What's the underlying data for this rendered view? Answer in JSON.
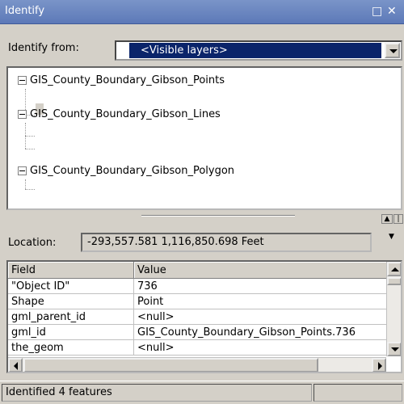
{
  "window": {
    "title": "Identify",
    "controls": {
      "restore": "□",
      "close": "✕"
    }
  },
  "identify_from": {
    "label": "Identify from:",
    "selected": "<Visible layers>"
  },
  "tree": {
    "layers": [
      {
        "name": "GIS_County_Boundary_Gibson_Points"
      },
      {
        "name": "GIS_County_Boundary_Gibson_Lines"
      },
      {
        "name": "GIS_County_Boundary_Gibson_Polygon"
      }
    ]
  },
  "location": {
    "label": "Location:",
    "value": "-293,557.581  1,116,850.698 Feet"
  },
  "grid": {
    "columns": [
      "Field",
      "Value"
    ],
    "rows": [
      [
        "\"Object ID\"",
        "736"
      ],
      [
        "Shape",
        "Point"
      ],
      [
        "gml_parent_id",
        "<null>"
      ],
      [
        "gml_id",
        "GIS_County_Boundary_Gibson_Points.736"
      ],
      [
        "the_geom",
        "<null>"
      ]
    ]
  },
  "status": {
    "text": "Identified 4 features"
  },
  "icons": {
    "dropdown": "chevron-down-icon",
    "expander": "collapse-minus-icon"
  },
  "colors": {
    "titlebar": "#5d79b8",
    "selection": "#0a246a",
    "window_bg": "#d4d0c8"
  }
}
